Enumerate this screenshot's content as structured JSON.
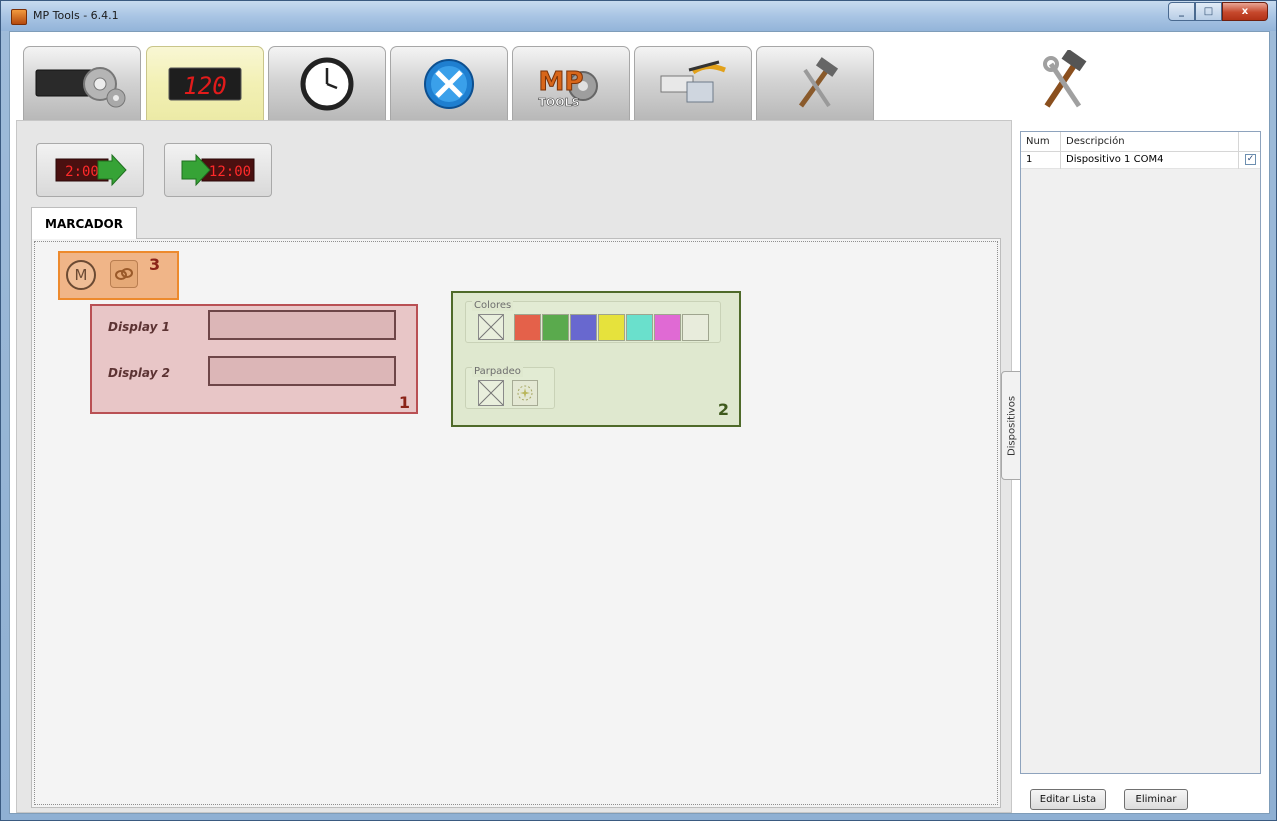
{
  "window": {
    "title": "MP Tools - 6.4.1",
    "minimize_glyph": "_",
    "maximize_glyph": "□",
    "close_glyph": "x"
  },
  "tabs": [
    {
      "name": "display-config-icon",
      "active": false
    },
    {
      "name": "led-scoreboard-icon",
      "active": true,
      "digits": "120"
    },
    {
      "name": "clock-icon",
      "active": false
    },
    {
      "name": "tools-globe-icon",
      "active": false
    },
    {
      "name": "mp-tools-logo-icon",
      "active": false
    },
    {
      "name": "serial-cable-icon",
      "active": false
    },
    {
      "name": "hammer-wrench-icon",
      "active": false
    }
  ],
  "actions": [
    {
      "name": "send-to-display-icon",
      "digits": "2:00"
    },
    {
      "name": "read-from-display-icon",
      "digits": "12:00"
    }
  ],
  "subtab": {
    "label": "MARCADOR"
  },
  "annotations": {
    "box1": "1",
    "box2": "2",
    "box3": "3"
  },
  "controls": {
    "mode_button": "M",
    "display1_label": "Display 1",
    "display2_label": "Display 2",
    "display1_value": "",
    "display2_value": ""
  },
  "colors_group": {
    "title": "Colores",
    "swatches": [
      "#e4614a",
      "#5aaa4d",
      "#6868cf",
      "#e6e23c",
      "#6ae0cc",
      "#e06ad4",
      "#e8ecdc"
    ]
  },
  "blink_group": {
    "title": "Parpadeo"
  },
  "side_tab": {
    "label": "Dispositivos"
  },
  "devices": {
    "columns": [
      "Num",
      "Descripción",
      ""
    ],
    "rows": [
      {
        "num": "1",
        "description": "Dispositivo 1 COM4",
        "checked": true
      }
    ]
  },
  "buttons": {
    "edit_list": "Editar Lista",
    "delete": "Eliminar"
  }
}
